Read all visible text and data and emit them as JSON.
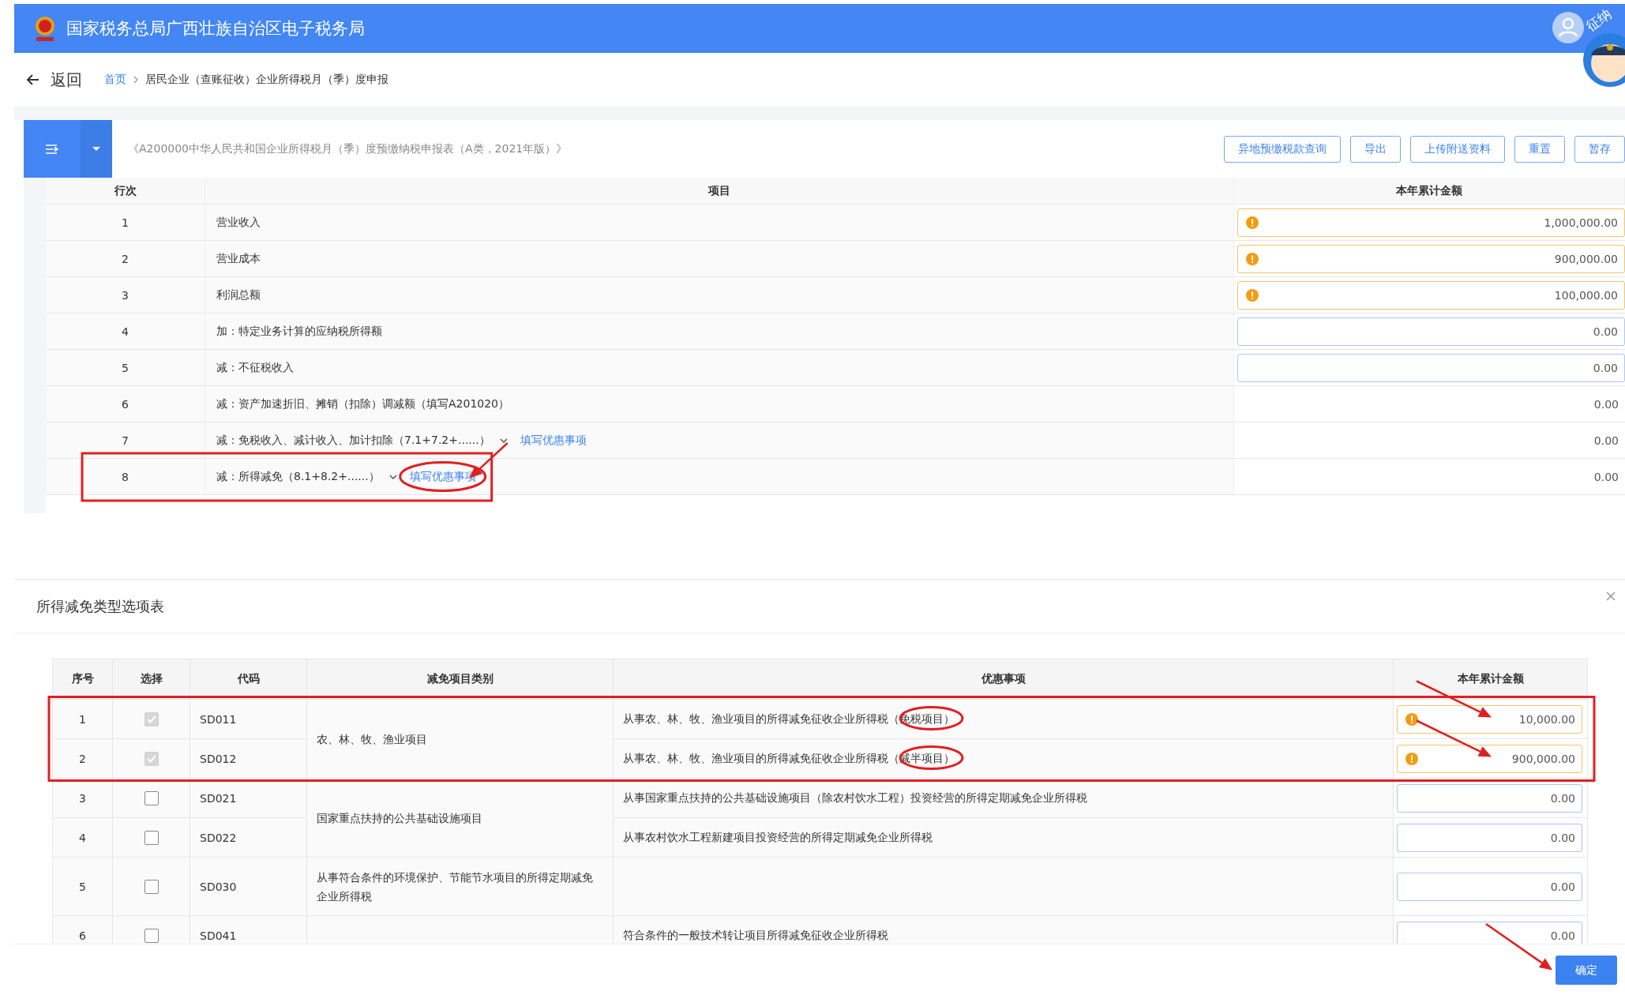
{
  "header": {
    "title": "国家税务总局广西壮族自治区电子税务局",
    "mascot_badge": "征纳"
  },
  "breadcrumb": {
    "back": "返回",
    "home": "首页",
    "current": "居民企业（查账征收）企业所得税月（季）度申报"
  },
  "form": {
    "title": "《A200000中华人民共和国企业所得税月（季）度预缴纳税申报表（A类，2021年版）》",
    "buttons": [
      "异地预缴税款查询",
      "导出",
      "上传附送资料",
      "重置",
      "暂存"
    ],
    "columns": [
      "行次",
      "项目",
      "本年累计金额"
    ],
    "rows": [
      {
        "no": "1",
        "item": "营业收入",
        "amount": "1,000,000.00",
        "kind": "warn"
      },
      {
        "no": "2",
        "item": "营业成本",
        "amount": "900,000.00",
        "kind": "warn"
      },
      {
        "no": "3",
        "item": "利润总额",
        "amount": "100,000.00",
        "kind": "warn"
      },
      {
        "no": "4",
        "item": "加：特定业务计算的应纳税所得额",
        "amount": "0.00",
        "kind": "input"
      },
      {
        "no": "5",
        "item": "减：不征税收入",
        "amount": "0.00",
        "kind": "input"
      },
      {
        "no": "6",
        "item": "减：资产加速折旧、摊销（扣除）调减额（填写A201020）",
        "amount": "0.00",
        "kind": "text"
      },
      {
        "no": "7",
        "item": "减：免税收入、减计收入、加计扣除（7.1+7.2+......）",
        "link": "填写优惠事项",
        "amount": "0.00",
        "kind": "text"
      },
      {
        "no": "8",
        "item": "减：所得减免（8.1+8.2+......）",
        "link": "填写优惠事项",
        "amount": "0.00",
        "kind": "text",
        "annotated": true
      }
    ]
  },
  "dialog": {
    "title": "所得减免类型选项表",
    "columns": [
      "序号",
      "选择",
      "代码",
      "减免项目类别",
      "优惠事项",
      "本年累计金额"
    ],
    "groups": [
      {
        "category": "农、林、牧、渔业项目",
        "rows": [
          {
            "no": "1",
            "checked": true,
            "disabled": true,
            "code": "SD011",
            "item": "从事农、林、牧、渔业项目的所得减免征收企业所得税（免税项目）",
            "amount": "10,000.00",
            "kind": "warn",
            "annotated": true
          },
          {
            "no": "2",
            "checked": true,
            "disabled": true,
            "code": "SD012",
            "item": "从事农、林、牧、渔业项目的所得减免征收企业所得税（减半项目）",
            "amount": "900,000.00",
            "kind": "warn",
            "annotated": true
          }
        ]
      },
      {
        "category": "国家重点扶持的公共基础设施项目",
        "rows": [
          {
            "no": "3",
            "checked": false,
            "disabled": false,
            "code": "SD021",
            "item": "从事国家重点扶持的公共基础设施项目（除农村饮水工程）投资经营的所得定期减免企业所得税",
            "amount": "0.00",
            "kind": "input"
          },
          {
            "no": "4",
            "checked": false,
            "disabled": false,
            "code": "SD022",
            "item": "从事农村饮水工程新建项目投资经营的所得定期减免企业所得税",
            "amount": "0.00",
            "kind": "input"
          }
        ]
      },
      {
        "category": "从事符合条件的环境保护、节能节水项目的所得定期减免企业所得税",
        "rows": [
          {
            "no": "5",
            "checked": false,
            "disabled": false,
            "code": "SD030",
            "amount": "0.00",
            "kind": "input"
          }
        ]
      },
      {
        "rows": [
          {
            "no": "6",
            "checked": false,
            "disabled": false,
            "code": "SD041",
            "item": "符合条件的一般技术转让项目所得减免征收企业所得税",
            "amount": "0.00",
            "kind": "input"
          }
        ]
      }
    ],
    "confirm": {
      "label": "确定",
      "annotated": true
    }
  }
}
